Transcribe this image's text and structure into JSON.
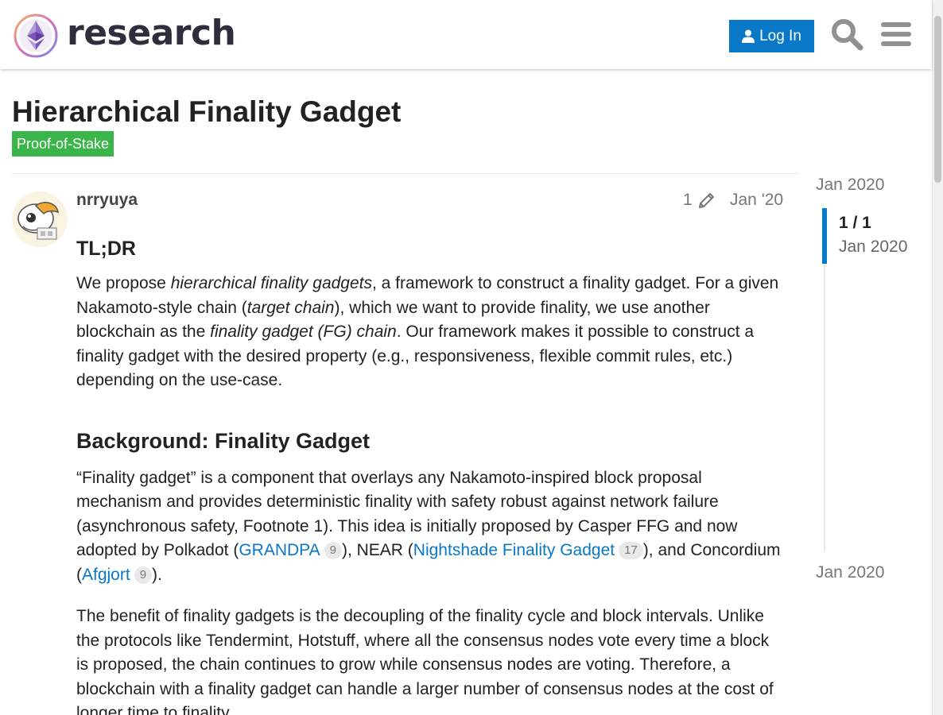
{
  "header": {
    "site_name": "research",
    "login_label": "Log In"
  },
  "topic": {
    "title": "Hierarchical Finality Gadget",
    "category": "Proof-of-Stake",
    "category_color": "#3ab54a"
  },
  "post": {
    "username": "nrryuya",
    "edit_count": "1",
    "date": "Jan '20",
    "tldr_heading": "TL;DR",
    "tldr": [
      "We propose ",
      "hierarchical finality gadgets",
      ", a framework to construct a finality gadget. For a given Nakamoto-style chain (",
      "target chain",
      "), which we want to provide finality, we use another blockchain as the ",
      "finality gadget (FG) chain",
      ". Our framework makes it possible to construct a finality gadget with the desired property (e.g., responsiveness, flexible commit rules, etc.) depending on the use-case."
    ],
    "background_heading": "Background: Finality Gadget",
    "background": {
      "text1": "“Finality gadget” is a component that overlays any Nakamoto-inspired block proposal mechanism and provides deterministic finality with safety robust against network failure (asynchronous safety, Footnote 1). This idea is initially proposed by Casper FFG and now adopted by Polkadot (",
      "link1": "GRANDPA",
      "link1_count": "9",
      "text2": "), NEAR (",
      "link2": "Nightshade Finality Gadget",
      "link2_count": "17",
      "text3": "), and Concordium (",
      "link3": "Afgjort",
      "link3_count": "9",
      "text4": ")."
    },
    "benefit": "The benefit of finality gadgets is the decoupling of the finality cycle and block intervals. Unlike the protocols like Tendermint, Hotstuff, where all the consensus nodes vote every time a block is proposed, the chain continues to grow while consensus nodes are voting. Therefore, a blockchain with a finality gadget can handle a larger number of consensus nodes at the cost of longer time to finality."
  },
  "timeline": {
    "start_date": "Jan 2020",
    "position": "1 / 1",
    "position_date": "Jan 2020",
    "end_date": "Jan 2020"
  },
  "colors": {
    "accent": "#0a78c8",
    "text": "#222222",
    "muted": "#777777"
  }
}
